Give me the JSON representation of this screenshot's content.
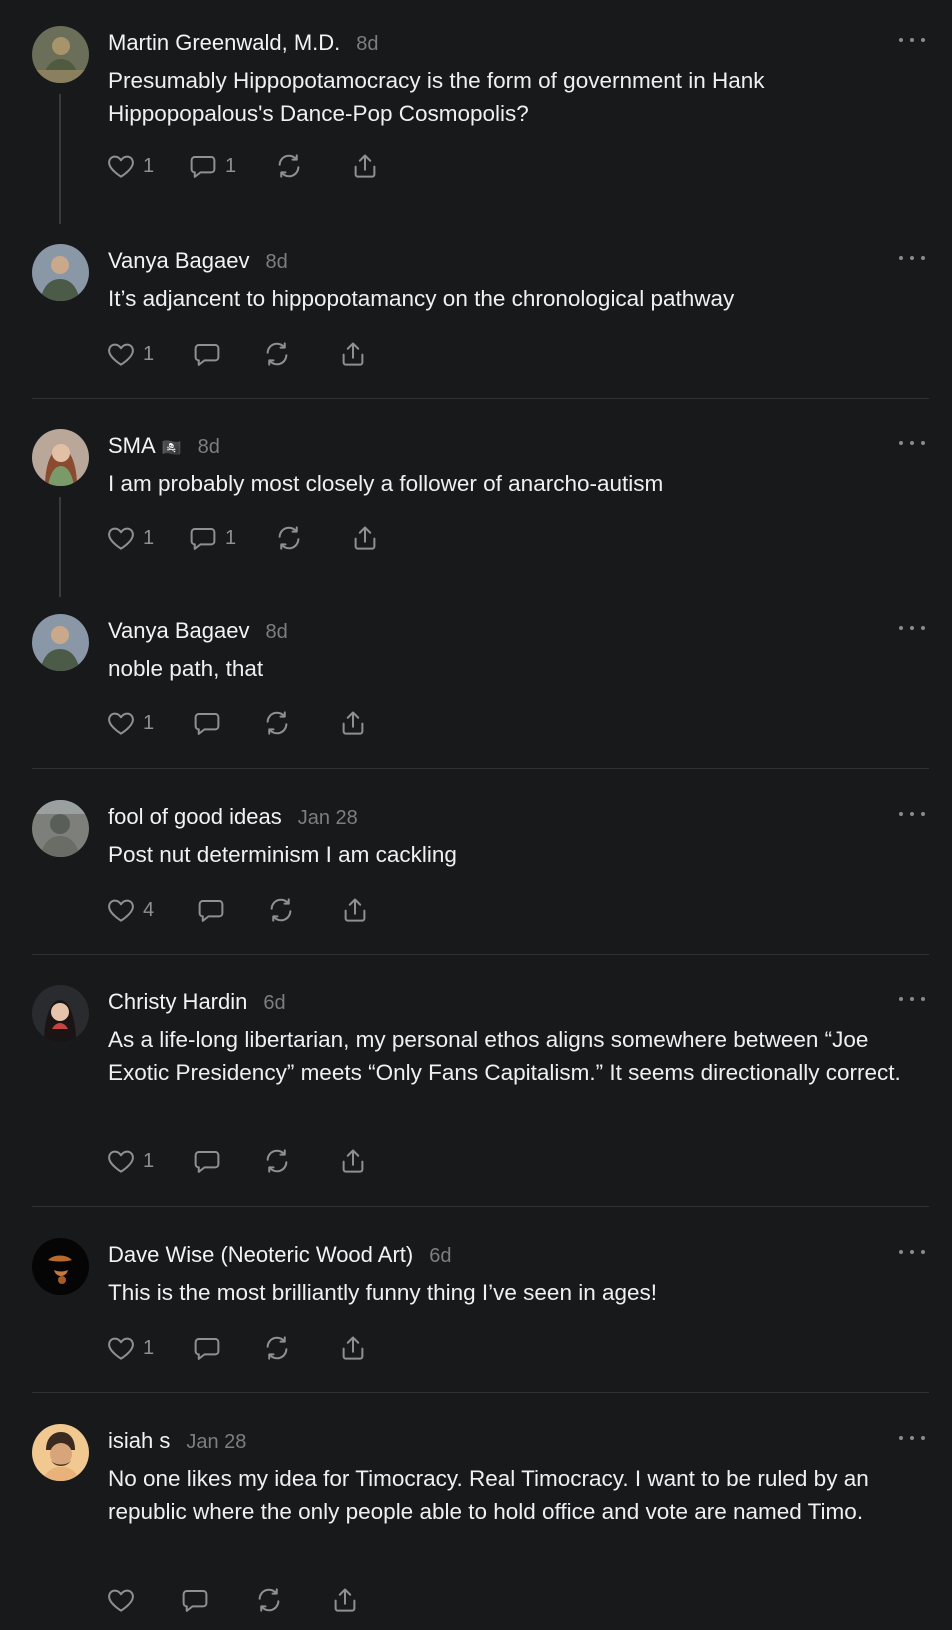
{
  "posts": [
    {
      "author": "Martin Greenwald, M.D.",
      "time": "8d",
      "text": "Presumably Hippopotamocracy is the form of government in Hank Hippopopalous's Dance-Pop Cosmopolis?",
      "likes": "1",
      "replies": "1"
    },
    {
      "author": "Vanya Bagaev",
      "time": "8d",
      "text": "It’s adjancent to hippopotamancy on the chronological pathway",
      "likes": "1",
      "replies": ""
    },
    {
      "author": "SMA",
      "flag": "🏴‍☠️",
      "time": "8d",
      "text": "I am probably most closely a follower of anarcho-autism",
      "likes": "1",
      "replies": "1"
    },
    {
      "author": "Vanya Bagaev",
      "time": "8d",
      "text": "noble path, that",
      "likes": "1",
      "replies": ""
    },
    {
      "author": "fool of good ideas",
      "time": "Jan 28",
      "text": "Post nut determinism I am cackling",
      "likes": "4",
      "replies": ""
    },
    {
      "author": "Christy Hardin",
      "time": "6d",
      "text": "As a life-long libertarian, my personal ethos aligns somewhere between “Joe Exotic Presidency” meets “Only Fans Capitalism.” It seems directionally correct.",
      "likes": "1",
      "replies": ""
    },
    {
      "author": "Dave Wise (Neoteric Wood Art)",
      "time": "6d",
      "text": "This is the most brilliantly funny thing I’ve seen in ages!",
      "likes": "1",
      "replies": ""
    },
    {
      "author": "isiah s",
      "time": "Jan 28",
      "text": "No one likes my idea for Timocracy. Real Timocracy. I want to be ruled by an republic where the only people able to hold office and vote are named Timo.",
      "likes": "",
      "replies": ""
    }
  ],
  "icons": {
    "like": "heart-icon",
    "reply": "comment-icon",
    "restack": "restack-icon",
    "share": "share-icon",
    "more": "more-icon"
  },
  "colors": {
    "background": "#18191b",
    "text": "#f2f2f2",
    "muted": "#7d7e82",
    "icon": "#8f9094",
    "divider": "#303134"
  }
}
